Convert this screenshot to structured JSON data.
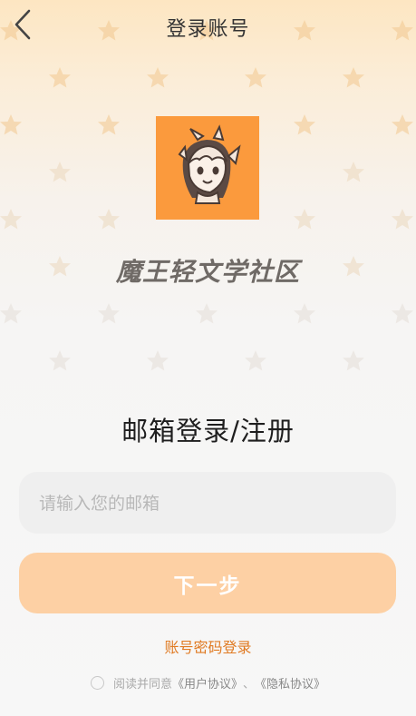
{
  "header": {
    "title": "登录账号",
    "back_icon": "chevron-left-icon"
  },
  "brand": {
    "logo_icon": "mascot-logo",
    "name": "魔王轻文学社区"
  },
  "form": {
    "heading": "邮箱登录/注册",
    "email_placeholder": "请输入您的邮箱",
    "email_value": "",
    "next_label": "下一步",
    "password_login_label": "账号密码登录"
  },
  "agreement": {
    "prefix": "阅读并同意",
    "user_agreement": "《用户协议》",
    "separator": "、",
    "privacy_agreement": "《隐私协议》",
    "checked": false
  },
  "colors": {
    "accent": "#e07a22",
    "button_disabled": "#fdd0a4",
    "logo_bg": "#fb9a3d"
  }
}
